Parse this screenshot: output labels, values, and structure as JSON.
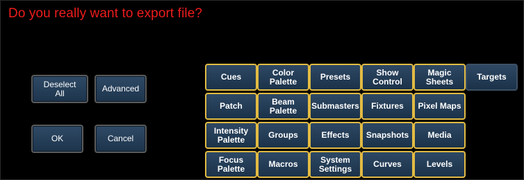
{
  "dialog": {
    "prompt": "Do you really want to export file?",
    "buttons": {
      "deselect_all": "Deselect\nAll",
      "advanced": "Advanced",
      "ok": "OK",
      "cancel": "Cancel"
    }
  },
  "targets": [
    "Cues",
    "Color\nPalette",
    "Presets",
    "Show\nControl",
    "Magic\nSheets",
    "Targets",
    "Patch",
    "Beam\nPalette",
    "Submasters",
    "Fixtures",
    "Pixel Maps",
    "Intensity\nPalette",
    "Groups",
    "Effects",
    "Snapshots",
    "Media",
    "Focus\nPalette",
    "Macros",
    "System\nSettings",
    "Curves",
    "Levels"
  ],
  "colors": {
    "prompt": "#ee1c1c",
    "selected_border": "#e2bb43",
    "button_fill": "#24405c"
  }
}
